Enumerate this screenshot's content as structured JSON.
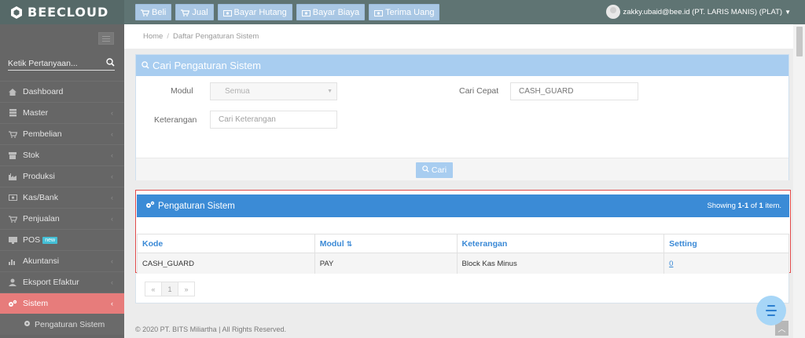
{
  "app": {
    "brand": "BEECLOUD"
  },
  "quick_nav": [
    {
      "label": "Beli",
      "icon": "cart-icon"
    },
    {
      "label": "Jual",
      "icon": "cart-icon"
    },
    {
      "label": "Bayar Hutang",
      "icon": "money-icon"
    },
    {
      "label": "Bayar Biaya",
      "icon": "money-icon"
    },
    {
      "label": "Terima Uang",
      "icon": "money-icon"
    }
  ],
  "user": {
    "label": "zakky.ubaid@bee.id (PT. LARIS MANIS) (PLAT)"
  },
  "sidebar": {
    "search_placeholder": "Ketik Pertanyaan...",
    "items": [
      {
        "label": "Dashboard",
        "icon": "home-icon"
      },
      {
        "label": "Master",
        "icon": "database-icon"
      },
      {
        "label": "Pembelian",
        "icon": "cart-icon"
      },
      {
        "label": "Stok",
        "icon": "box-icon"
      },
      {
        "label": "Produksi",
        "icon": "factory-icon"
      },
      {
        "label": "Kas/Bank",
        "icon": "money-icon"
      },
      {
        "label": "Penjualan",
        "icon": "cart-icon"
      },
      {
        "label": "POS",
        "icon": "monitor-icon",
        "badge": "new"
      },
      {
        "label": "Akuntansi",
        "icon": "bar-chart-icon"
      },
      {
        "label": "Eksport Efaktur",
        "icon": "user-icon"
      },
      {
        "label": "Sistem",
        "icon": "gears-icon",
        "active": true
      }
    ],
    "sub_items": [
      {
        "label": "Pengaturan Sistem",
        "icon": "gear-icon"
      }
    ]
  },
  "breadcrumb": {
    "home": "Home",
    "sep": "/",
    "current": "Daftar Pengaturan Sistem"
  },
  "search_panel": {
    "title": "Cari Pengaturan Sistem",
    "modul_label": "Modul",
    "modul_value": "Semua",
    "cari_cepat_label": "Cari Cepat",
    "cari_cepat_value": "CASH_GUARD",
    "keterangan_label": "Keterangan",
    "keterangan_placeholder": "Cari Keterangan",
    "cari_button": "Cari"
  },
  "result_panel": {
    "title": "Pengaturan Sistem",
    "summary_prefix": "Showing ",
    "summary_range": "1-1",
    "summary_mid": " of ",
    "summary_total": "1",
    "summary_suffix": " item.",
    "columns": [
      "Kode",
      "Modul",
      "Keterangan",
      "Setting"
    ],
    "rows": [
      {
        "kode": "CASH_GUARD",
        "modul": "PAY",
        "keterangan": "Block Kas Minus",
        "setting": "0"
      }
    ]
  },
  "pagination": {
    "prev": "«",
    "current": "1",
    "next": "»"
  },
  "footer": {
    "copyright": "© 2020 PT. BITS Miliartha | All Rights Reserved."
  },
  "colors": {
    "topbar": "#5f7473",
    "sidebar": "#666666",
    "sidebar_active": "#e77c7b",
    "panel_header_light": "#a8cdf0",
    "panel_header_dark": "#3b8bd6",
    "highlight_border": "#e04a4a"
  }
}
